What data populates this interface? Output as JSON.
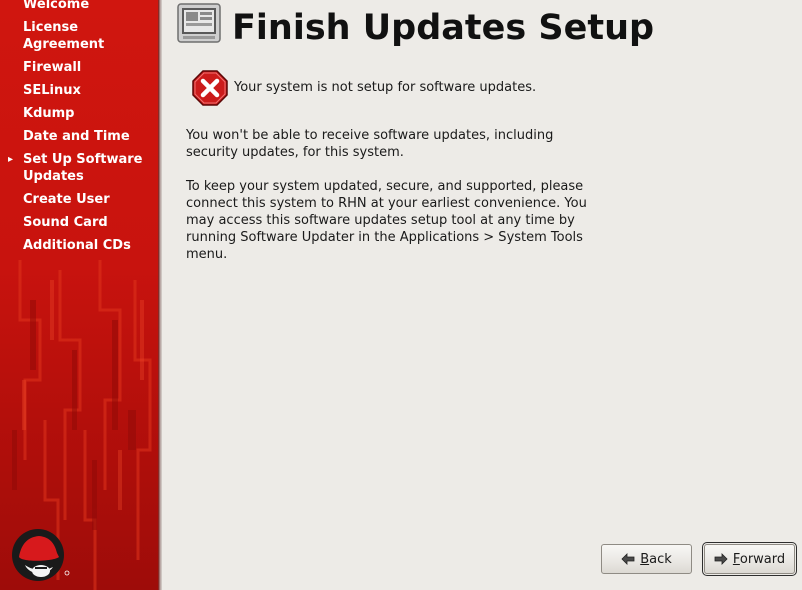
{
  "sidebar": {
    "current_step_marker": "▸",
    "steps": [
      {
        "label": "Welcome"
      },
      {
        "label": "License Agreement"
      },
      {
        "label": "Firewall"
      },
      {
        "label": "SELinux"
      },
      {
        "label": "Kdump"
      },
      {
        "label": "Date and Time"
      },
      {
        "label": "Set Up Software Updates",
        "current": true
      },
      {
        "label": "Create User"
      },
      {
        "label": "Sound Card"
      },
      {
        "label": "Additional CDs"
      }
    ],
    "logo": "redhat-shadowman-logo",
    "accent_color": "#cc1510"
  },
  "main": {
    "header_icon": "computer-window-icon",
    "title": "Finish Updates Setup",
    "error_icon": "error-x-icon",
    "error_message": "Your system is not setup for software updates.",
    "paragraphs": [
      "You won't be able to receive software updates, including security updates, for this system.",
      "To keep your system updated, secure, and supported, please connect this system to RHN at your earliest convenience. You may access this software updates setup tool at any time by running Software Updater in the Applications > System Tools menu."
    ]
  },
  "buttons": {
    "back": {
      "mnemonic": "B",
      "rest": "ack",
      "icon": "arrow-left-icon"
    },
    "forward": {
      "mnemonic": "F",
      "rest": "orward",
      "icon": "arrow-right-icon"
    }
  }
}
